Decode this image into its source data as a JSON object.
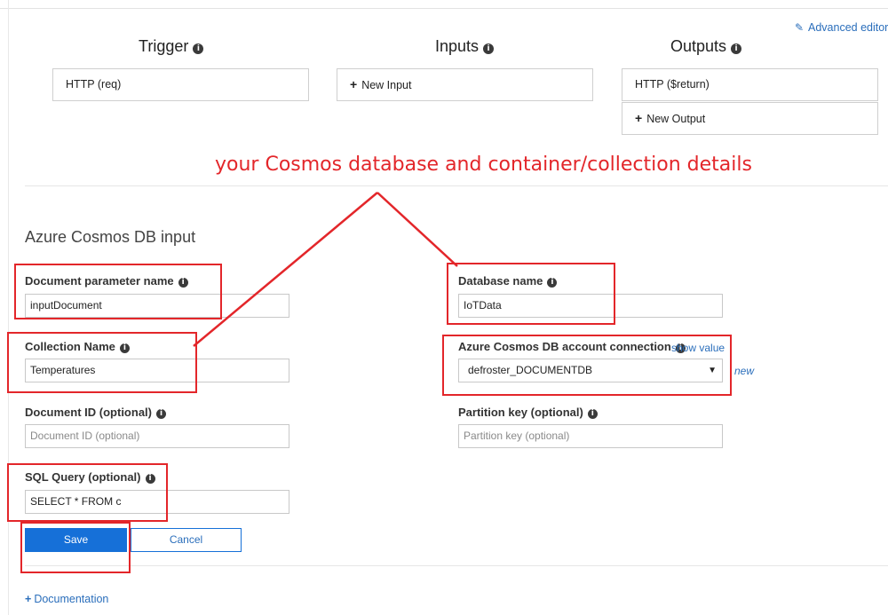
{
  "header": {
    "advanced_editor": "Advanced editor",
    "columns": {
      "trigger": "Trigger",
      "inputs": "Inputs",
      "outputs": "Outputs"
    }
  },
  "bindings": {
    "trigger": "HTTP (req)",
    "new_input": "New Input",
    "output": "HTTP ($return)",
    "new_output": "New Output"
  },
  "annotation": "your Cosmos database and container/collection details",
  "form": {
    "title": "Azure Cosmos DB input",
    "document_param_label": "Document parameter name",
    "document_param_value": "inputDocument",
    "database_label": "Database name",
    "database_value": "IoTData",
    "collection_label": "Collection Name",
    "collection_value": "Temperatures",
    "connection_label": "Azure Cosmos DB account connection",
    "connection_show_value": "show value",
    "connection_value": "defroster_DOCUMENTDB",
    "connection_new": "new",
    "document_id_label": "Document ID (optional)",
    "document_id_placeholder": "Document ID (optional)",
    "partition_label": "Partition key (optional)",
    "partition_placeholder": "Partition key (optional)",
    "sql_label": "SQL Query (optional)",
    "sql_value": "SELECT * FROM c"
  },
  "buttons": {
    "save": "Save",
    "cancel": "Cancel"
  },
  "footer": {
    "documentation": "Documentation"
  },
  "icons": {
    "info": "info-circle-icon",
    "edit": "edit-icon",
    "plus": "plus-icon",
    "dropdown": "caret-down-icon"
  },
  "colors": {
    "accent": "#1670d8",
    "link": "#2a6ebb",
    "annotation": "#e3262a"
  }
}
